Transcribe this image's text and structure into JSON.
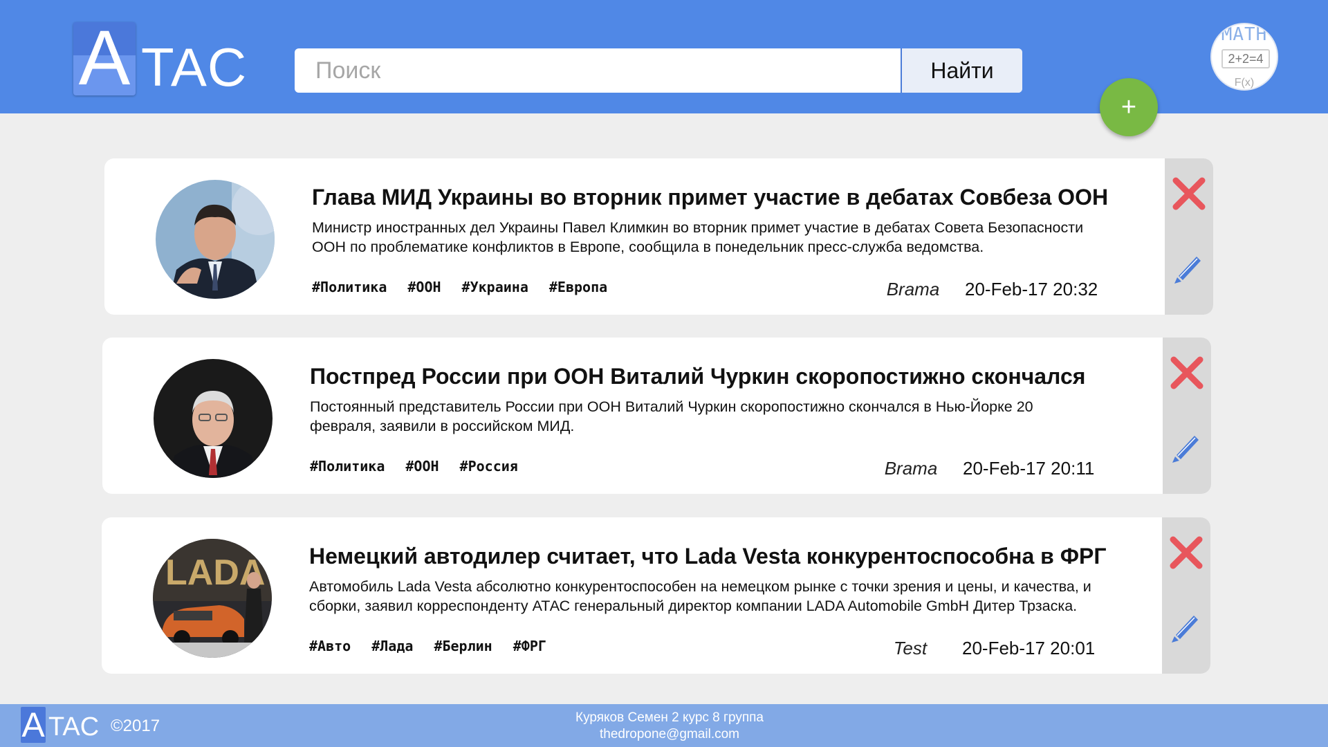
{
  "header": {
    "logo_letter": "A",
    "logo_rest": "TAC",
    "search_placeholder": "Поиск",
    "search_button": "Найти",
    "avatar_top": "MATH",
    "avatar_eq": "2+2=4",
    "avatar_fx": "F(x)",
    "add_label": "+"
  },
  "articles": [
    {
      "title": "Глава МИД Украины во вторник примет участие в дебатах Совбеза ООН",
      "text": "Министр иностранных дел Украины Павел Климкин во вторник примет участие в дебатах Совета Безопасности ООН по проблематике конфликтов в Европе, сообщила в понедельник пресс-служба ведомства.",
      "tags": [
        "#Политика",
        "#ООН",
        "#Украина",
        "#Европа"
      ],
      "author": "Brama",
      "date": "20-Feb-17 20:32"
    },
    {
      "title": "Постпред России при ООН Виталий Чуркин скоропостижно скончался",
      "text": "Постоянный представитель России при ООН Виталий Чуркин скоропостижно скончался в Нью-Йорке 20 февраля, заявили в российском МИД.",
      "tags": [
        "#Политика",
        "#ООН",
        "#Россия"
      ],
      "author": "Brama",
      "date": "20-Feb-17 20:11"
    },
    {
      "title": "Немецкий автодилер считает, что Lada Vesta конкурентоспособна в ФРГ",
      "text": "Автомобиль Lada Vesta абсолютно конкурентоспособен на немецком рынке с точки зрения и цены, и качества, и сборки, заявил корреспонденту АТАС генеральный директор компании LADA Automobile GmbH Дитер Трзаска.",
      "tags": [
        "#Авто",
        "#Лада",
        "#Берлин",
        "#ФРГ"
      ],
      "author": "Test",
      "date": "20-Feb-17 20:01",
      "photo_text": "LADA"
    }
  ],
  "footer": {
    "logo_letter": "A",
    "logo_rest": "TAC",
    "copyright": "©2017",
    "author_line": "Куряков Семен 2 курс 8 группа",
    "email": "thedropone@gmail.com"
  },
  "colors": {
    "header": "#5088e6",
    "footer": "#82a9e6",
    "add_button": "#79b944",
    "delete": "#e8565c",
    "edit": "#4b7cd8"
  }
}
